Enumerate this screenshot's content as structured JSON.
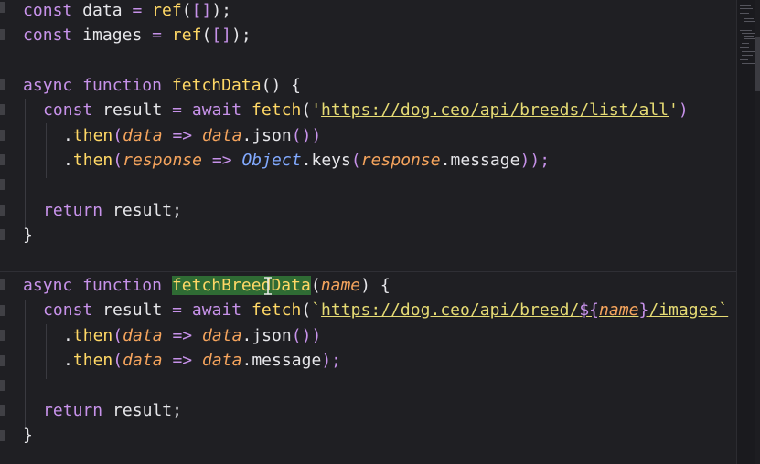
{
  "code": {
    "l1": {
      "a": "const",
      "b": " data ",
      "c": "=",
      "d": " ",
      "e": "ref",
      "f": "(",
      "g": "[]",
      "h": ");"
    },
    "l2": {
      "a": "const",
      "b": " images ",
      "c": "=",
      "d": " ",
      "e": "ref",
      "f": "(",
      "g": "[]",
      "h": ");"
    },
    "l3": {
      "a": "async",
      "b": " ",
      "c": "function",
      "d": " ",
      "e": "fetchData",
      "f": "() {"
    },
    "l4": {
      "a": "const",
      "b": " result ",
      "c": "=",
      "d": " ",
      "e": "await",
      "f": " ",
      "g": "fetch",
      "h": "(",
      "i": "'",
      "j": "https://dog.ceo/api/breeds/list/all",
      "k": "'",
      "l": ")"
    },
    "l5": {
      "a": ".",
      "b": "then",
      "c": "(",
      "d": "data",
      "e": " => ",
      "f": "data",
      "g": ".json",
      "h": "())"
    },
    "l6": {
      "a": ".",
      "b": "then",
      "c": "(",
      "d": "response",
      "e": " => ",
      "f": "Object",
      "g": ".keys",
      "h": "(",
      "i": "response",
      "j": ".message",
      "k": "));"
    },
    "l7": {
      "a": "return",
      "b": " result;"
    },
    "l8": {
      "a": "}"
    },
    "l9": {
      "a": "async",
      "b": " ",
      "c": "function",
      "d": " ",
      "e": "fetchBreedData",
      "f": "(",
      "g": "name",
      "h": ") {"
    },
    "l10": {
      "a": "const",
      "b": " result ",
      "c": "=",
      "d": " ",
      "e": "await",
      "f": " ",
      "g": "fetch",
      "h": "(",
      "i": "`",
      "j": "https://dog.ceo/api/breed/",
      "k": "${",
      "l": "name",
      "m": "}",
      "n": "/images`"
    },
    "l11": {
      "a": ".",
      "b": "then",
      "c": "(",
      "d": "data",
      "e": " => ",
      "f": "data",
      "g": ".json",
      "h": "())"
    },
    "l12": {
      "a": ".",
      "b": "then",
      "c": "(",
      "d": "data",
      "e": " => ",
      "f": "data",
      "g": ".message",
      "h": ");"
    },
    "l13": {
      "a": "return",
      "b": " result;"
    },
    "l14": {
      "a": "}"
    }
  },
  "colors": {
    "background": "#1f1f23",
    "keyword": "#c792ea",
    "function": "#ffd866",
    "string": "#e6db74",
    "param": "#f5a45d",
    "selection": "#2f6b34"
  },
  "cursor_icon": "text-cursor-icon"
}
